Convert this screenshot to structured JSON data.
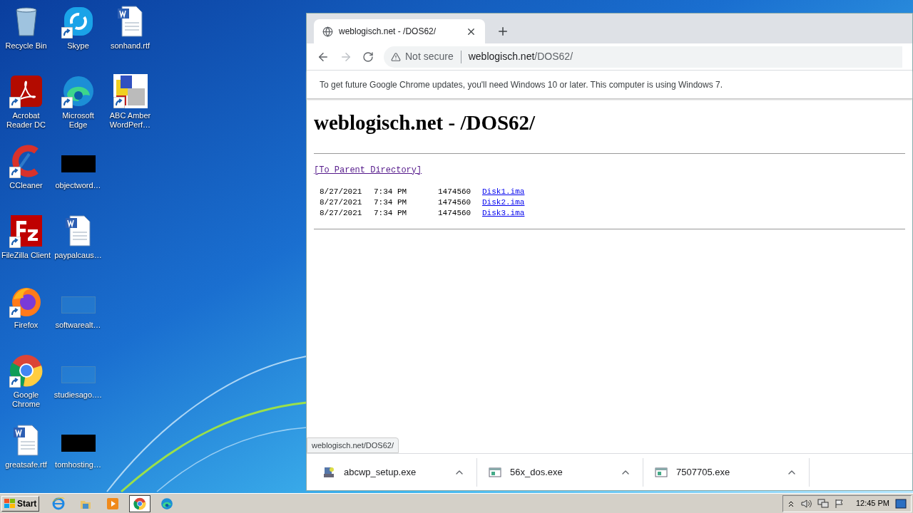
{
  "desktop": {
    "rows": [
      [
        {
          "label": "Recycle Bin",
          "kind": "recycle",
          "shortcut": false
        },
        {
          "label": "Skype",
          "kind": "skype",
          "shortcut": true
        },
        {
          "label": "sonhand.rtf",
          "kind": "word",
          "shortcut": false
        }
      ],
      [
        {
          "label": "Acrobat Reader DC",
          "kind": "acrobat",
          "shortcut": true
        },
        {
          "label": "Microsoft Edge",
          "kind": "edge",
          "shortcut": true
        },
        {
          "label": "ABC Amber WordPerf…",
          "kind": "abc",
          "shortcut": true
        }
      ],
      [
        {
          "label": "CCleaner",
          "kind": "ccleaner",
          "shortcut": true
        },
        {
          "label": "objectword…",
          "kind": "black",
          "shortcut": false
        }
      ],
      [
        {
          "label": "FileZilla Client",
          "kind": "filezilla",
          "shortcut": true
        },
        {
          "label": "paypalcaus…",
          "kind": "word",
          "shortcut": false
        }
      ],
      [
        {
          "label": "Firefox",
          "kind": "firefox",
          "shortcut": true
        },
        {
          "label": "softwarealt…",
          "kind": "blank",
          "shortcut": false
        }
      ],
      [
        {
          "label": "Google Chrome",
          "kind": "chrome",
          "shortcut": true
        },
        {
          "label": "studiesago.…",
          "kind": "blank",
          "shortcut": false
        }
      ],
      [
        {
          "label": "greatsafe.rtf",
          "kind": "word",
          "shortcut": false
        },
        {
          "label": "tomhosting…",
          "kind": "black",
          "shortcut": false
        }
      ]
    ]
  },
  "browser": {
    "tab": {
      "title": "weblogisch.net - /DOS62/"
    },
    "address": {
      "security": "Not secure",
      "host": "weblogisch.net",
      "path": "/DOS62/"
    },
    "infobar": "To get future Google Chrome updates, you'll need Windows 10 or later. This computer is using Windows 7.",
    "page": {
      "heading": "weblogisch.net - /DOS62/",
      "parent_link": "[To Parent Directory]",
      "files": [
        {
          "date": "8/27/2021",
          "time": "7:34 PM",
          "size": "1474560",
          "name": "Disk1.ima"
        },
        {
          "date": "8/27/2021",
          "time": "7:34 PM",
          "size": "1474560",
          "name": "Disk2.ima"
        },
        {
          "date": "8/27/2021",
          "time": "7:34 PM",
          "size": "1474560",
          "name": "Disk3.ima"
        }
      ]
    },
    "status_url": "weblogisch.net/DOS62/",
    "downloads": [
      {
        "name": "abcwp_setup.exe",
        "kind": "installer"
      },
      {
        "name": "56x_dos.exe",
        "kind": "app"
      },
      {
        "name": "7507705.exe",
        "kind": "app"
      }
    ]
  },
  "taskbar": {
    "start": "Start",
    "items": [
      {
        "kind": "ie",
        "selected": false
      },
      {
        "kind": "explorer",
        "selected": false
      },
      {
        "kind": "media",
        "selected": false
      },
      {
        "kind": "chrome",
        "selected": true
      },
      {
        "kind": "edge",
        "selected": false
      }
    ],
    "clock": "12:45 PM"
  }
}
